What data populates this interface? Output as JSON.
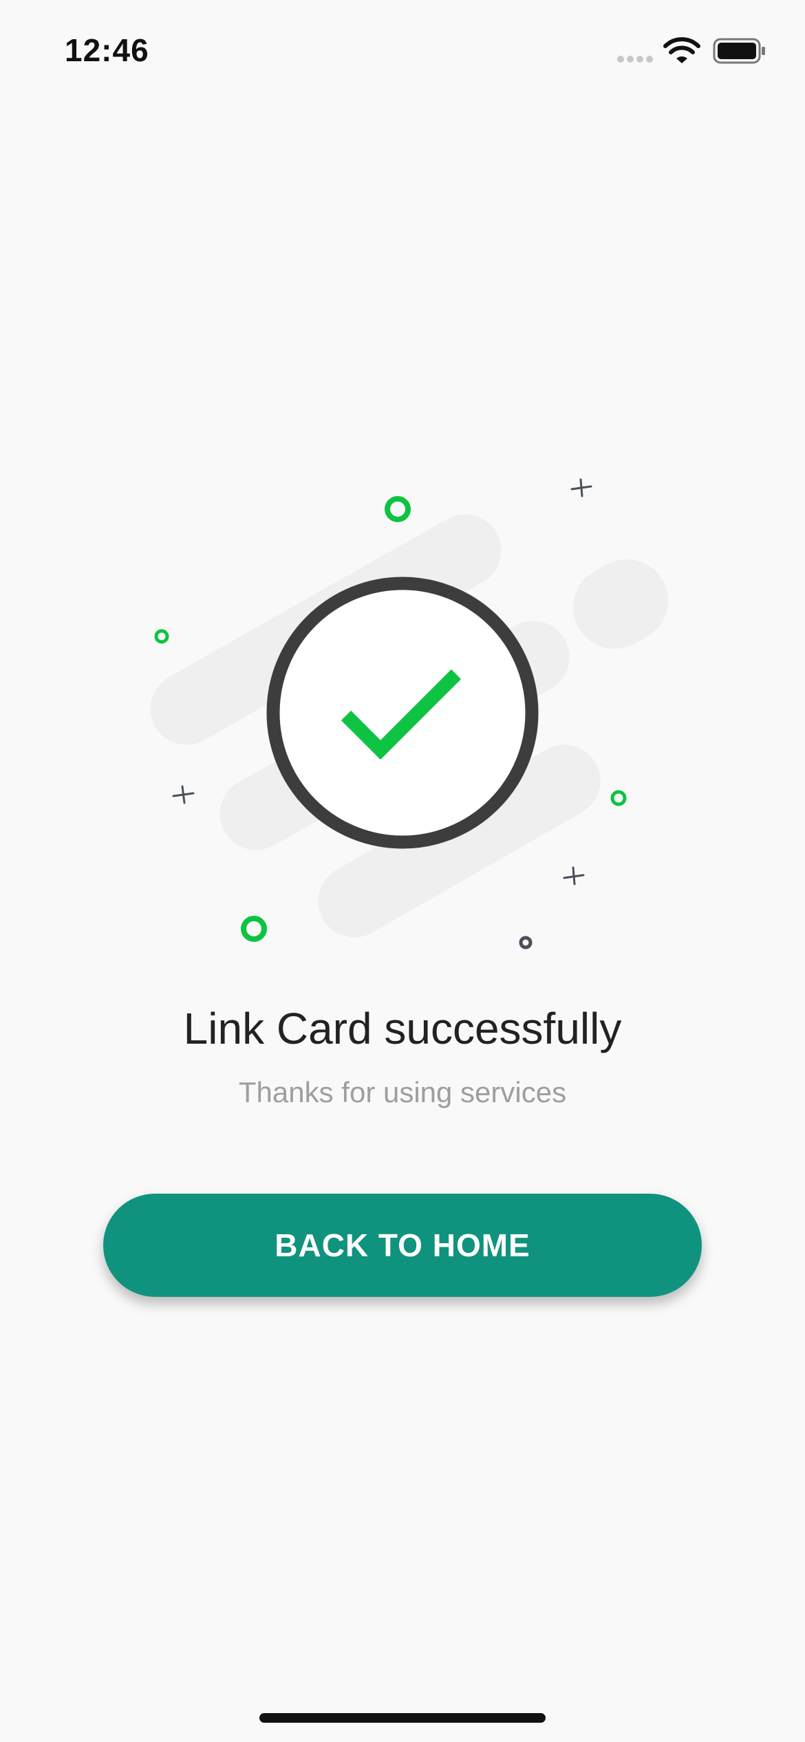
{
  "status_bar": {
    "time": "12:46",
    "icons": [
      "cellular-signal-icon",
      "wifi-icon",
      "battery-icon"
    ]
  },
  "illustration": {
    "icon": "checkmark-icon",
    "colors": {
      "check": "#0ec341",
      "ring": "#3d3d3d",
      "shapes": "#efefef",
      "accent_dots": "#0ec341",
      "decor_marks": "#4a4f5a"
    }
  },
  "result": {
    "title": "Link Card successfully",
    "subtitle": "Thanks for using services"
  },
  "actions": {
    "back_home_label": "BACK TO HOME"
  },
  "colors": {
    "background": "#f9f9f9",
    "primary_button": "#10937e",
    "button_text": "#ffffff"
  }
}
